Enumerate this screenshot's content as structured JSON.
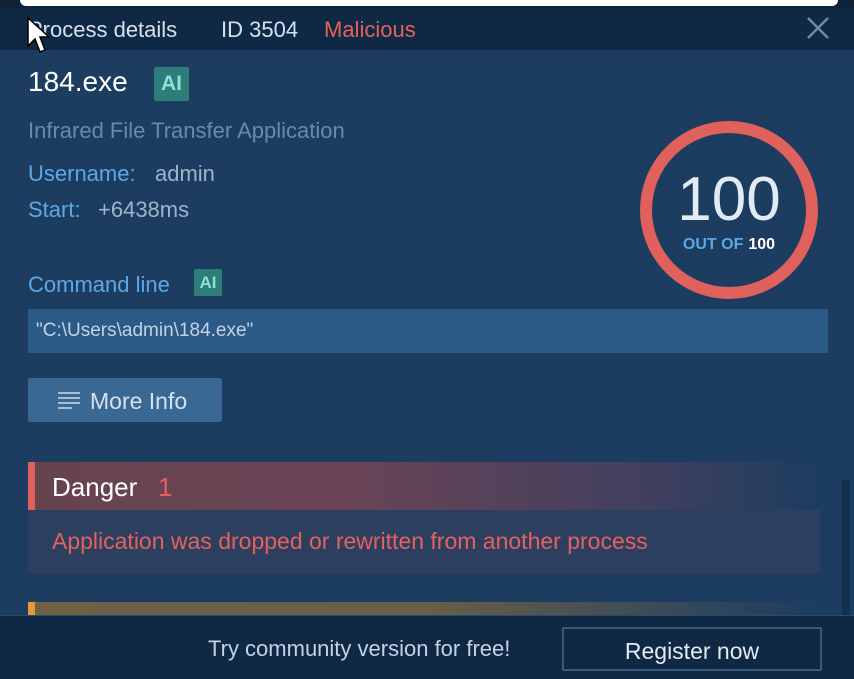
{
  "header": {
    "title": "Process details",
    "process_id": "ID 3504",
    "verdict": "Malicious"
  },
  "process": {
    "name": "184.exe",
    "ai_badge": "AI",
    "description": "Infrared File Transfer Application",
    "username_label": "Username:",
    "username_value": "admin",
    "start_label": "Start:",
    "start_value": "+6438ms"
  },
  "score": {
    "value": "100",
    "out_of_label": "OUT OF",
    "out_of_value": "100",
    "color": "#e0605c"
  },
  "command_line": {
    "label": "Command line",
    "ai_badge": "AI",
    "value": "\"C:\\Users\\admin\\184.exe\""
  },
  "more_info": {
    "label": "More Info",
    "icon": "list-icon"
  },
  "danger": {
    "title": "Danger",
    "count": "1",
    "items": [
      "Application was dropped or rewritten from another process"
    ],
    "color": "#e0605c"
  },
  "warning": {
    "color": "#e39a3a"
  },
  "footer": {
    "cta_text": "Try community version for free!",
    "register_label": "Register now"
  },
  "colors": {
    "background": "#1c3d5f",
    "header": "#0f2844",
    "accent_blue": "#5da7e8",
    "ai_badge": "#2e7d7b"
  }
}
